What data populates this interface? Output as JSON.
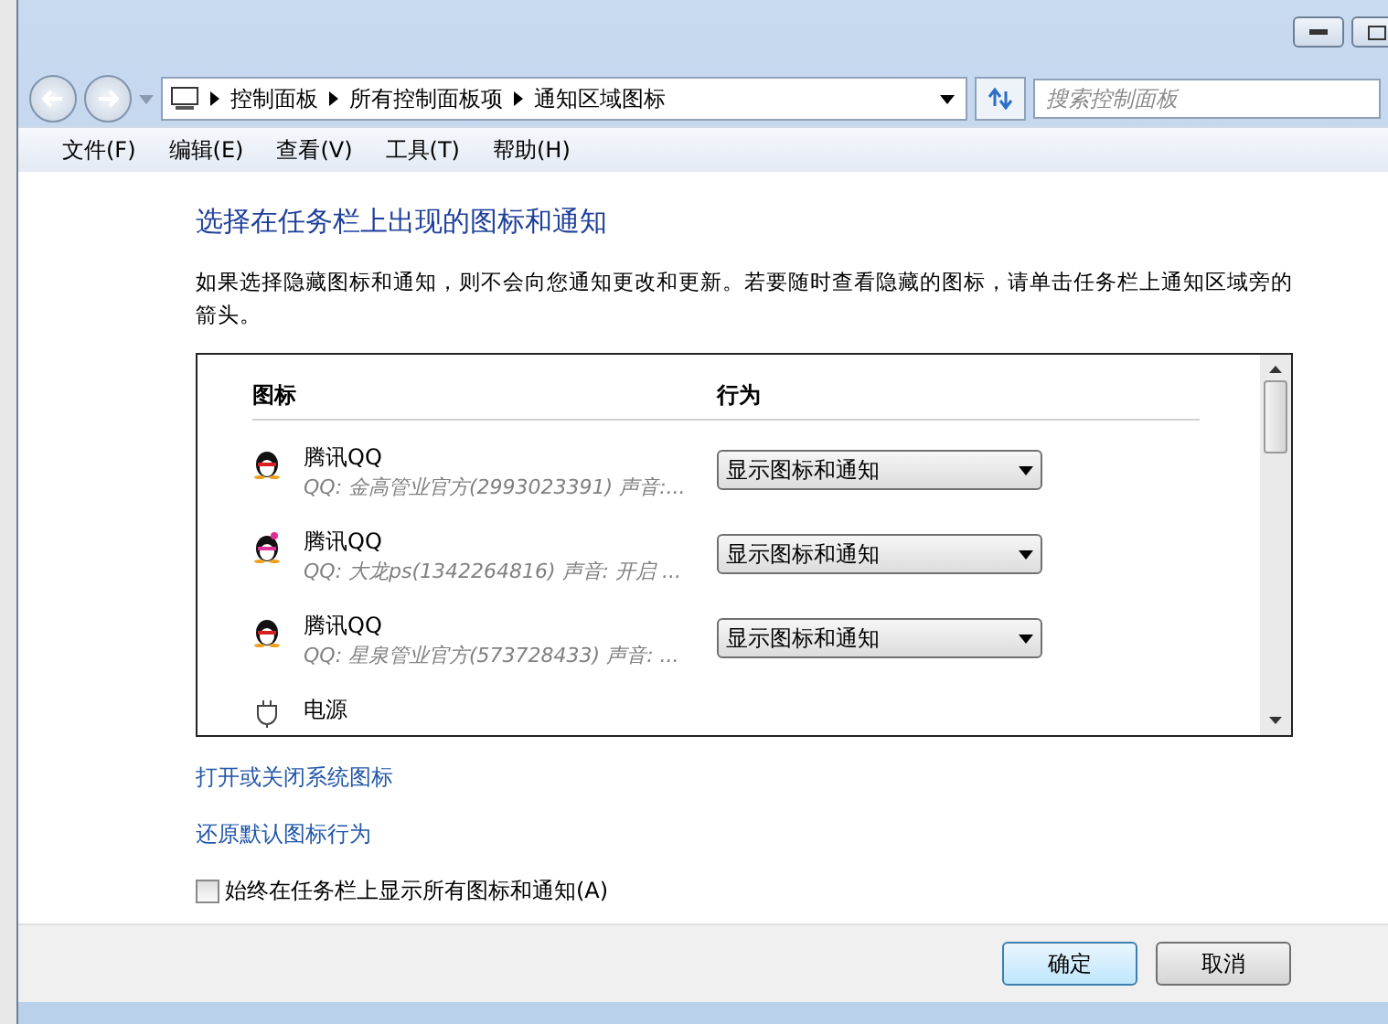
{
  "breadcrumb": [
    "控制面板",
    "所有控制面板项",
    "通知区域图标"
  ],
  "search": {
    "placeholder": "搜索控制面板"
  },
  "menu": [
    "文件(F)",
    "编辑(E)",
    "查看(V)",
    "工具(T)",
    "帮助(H)"
  ],
  "heading": "选择在任务栏上出现的图标和通知",
  "description": "如果选择隐藏图标和通知，则不会向您通知更改和更新。若要随时查看隐藏的图标，请单击任务栏上通知区域旁的箭头。",
  "table": {
    "columns": [
      "图标",
      "行为"
    ],
    "rows": [
      {
        "kind": "qq",
        "name": "腾讯QQ",
        "detail": "QQ: 金高管业官方(2993023391)  声音:...",
        "behavior": "显示图标和通知"
      },
      {
        "kind": "qq-pink",
        "name": "腾讯QQ",
        "detail": "QQ: 大龙ps(1342264816)  声音: 开启 ...",
        "behavior": "显示图标和通知"
      },
      {
        "kind": "qq",
        "name": "腾讯QQ",
        "detail": "QQ: 星泉管业官方(573728433)  声音: ...",
        "behavior": "显示图标和通知"
      },
      {
        "kind": "power",
        "name": "电源"
      }
    ]
  },
  "links": [
    "打开或关闭系统图标",
    "还原默认图标行为"
  ],
  "always_show": {
    "label": "始终在任务栏上显示所有图标和通知(A)",
    "checked": false
  },
  "buttons": [
    {
      "label": "确定",
      "selected": true
    },
    {
      "label": "取消",
      "selected": false
    }
  ]
}
